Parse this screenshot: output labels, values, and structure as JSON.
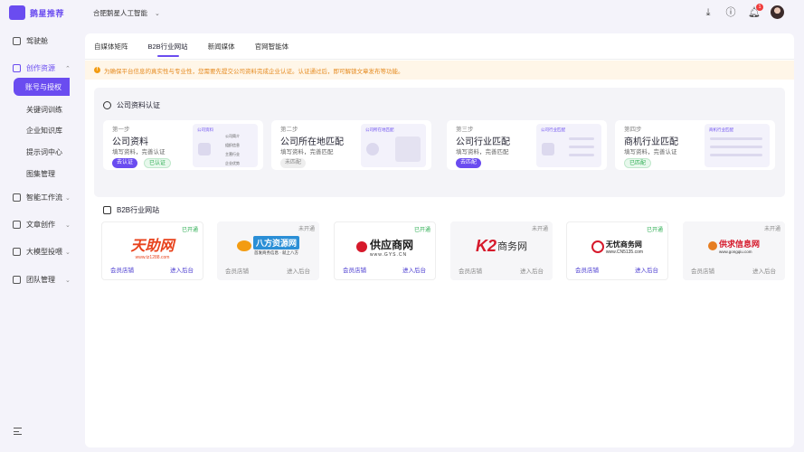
{
  "app": {
    "name": "鹅星推荐"
  },
  "topbar": {
    "company": "合肥鹅星人工智能",
    "notification_count": "1"
  },
  "sidebar": {
    "items": [
      {
        "label": "驾驶舱"
      },
      {
        "label": "创作资源"
      },
      {
        "label": "智能工作流"
      },
      {
        "label": "文章创作"
      },
      {
        "label": "大模型投喂"
      },
      {
        "label": "团队管理"
      }
    ],
    "sub_items": [
      {
        "label": "账号与授权"
      },
      {
        "label": "关键词训练"
      },
      {
        "label": "企业知识库"
      },
      {
        "label": "提示词中心"
      },
      {
        "label": "图集管理"
      }
    ]
  },
  "tabs": [
    {
      "label": "自媒体矩阵"
    },
    {
      "label": "B2B行业网站"
    },
    {
      "label": "新闻媒体"
    },
    {
      "label": "官网智能体"
    }
  ],
  "notice": "为确保平台信息的真实性与专业性，您需要先提交公司资料完成企业认证。认证通过后，即可解锁文章发布等功能。",
  "certification": {
    "title": "公司资料认证",
    "steps": [
      {
        "step": "第一步",
        "title": "公司资料",
        "desc": "填写资料，完善认证",
        "actions": [
          "去认证",
          "已认证"
        ],
        "mock_title": "公司资料",
        "mock_items": [
          "公司简介",
          "组织信息",
          "主营行业",
          "企业优势"
        ]
      },
      {
        "step": "第二步",
        "title": "公司所在地匹配",
        "desc": "填写资料，完善匹配",
        "actions": [
          "未匹配"
        ],
        "mock_title": "公司所在地匹配",
        "mock_items": []
      },
      {
        "step": "第三步",
        "title": "公司行业匹配",
        "desc": "填写资料，完善匹配",
        "actions": [
          "去匹配"
        ],
        "mock_title": "公司行业匹配",
        "mock_items": []
      },
      {
        "step": "第四步",
        "title": "商机行业匹配",
        "desc": "填写资料，完善认证",
        "actions": [
          "已匹配"
        ],
        "mock_title": "商机行业匹配",
        "mock_items": []
      }
    ]
  },
  "b2b": {
    "title": "B2B行业网站",
    "sites": [
      {
        "status": "已开通",
        "logo_main": "天助网",
        "logo_sub": "www.tz1288.com",
        "shop": "会员店铺",
        "backend": "进入后台"
      },
      {
        "status": "未开通",
        "logo_main": "八方资源网",
        "logo_sub": "首发商务信息 · 就上八方",
        "shop": "会员店铺",
        "backend": "进入后台"
      },
      {
        "status": "已开通",
        "logo_main": "供应商网",
        "logo_sub": "www.GYS.CN",
        "shop": "会员店铺",
        "backend": "进入后台"
      },
      {
        "status": "未开通",
        "logo_main": "K2",
        "logo_main2": "商务网",
        "logo_sub": "",
        "shop": "会员店铺",
        "backend": "进入后台"
      },
      {
        "status": "已开通",
        "logo_main": "无忧商务网",
        "logo_sub": "www.CN5135.com",
        "shop": "会员店铺",
        "backend": "进入后台"
      },
      {
        "status": "未开通",
        "logo_main": "供求信息网",
        "logo_sub": "www.gongqiu.com",
        "shop": "会员店铺",
        "backend": "进入后台"
      }
    ]
  },
  "colors": {
    "accent": "#6a4cf0",
    "success": "#2fae54",
    "warning": "#e58a1f",
    "danger": "#f03c3c"
  }
}
